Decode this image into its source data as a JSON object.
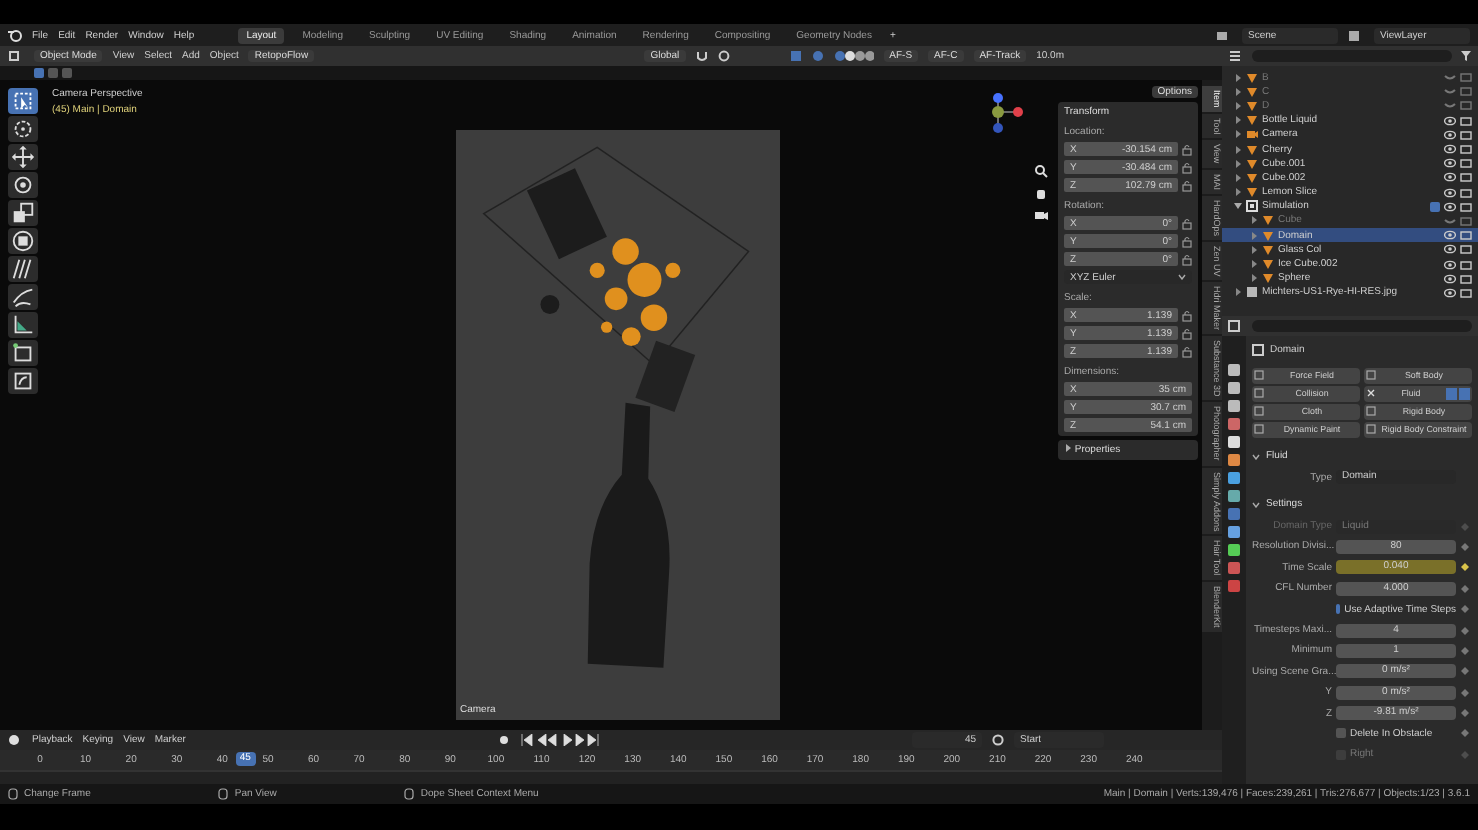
{
  "menu_bar": {
    "menus": [
      "File",
      "Edit",
      "Render",
      "Window",
      "Help"
    ],
    "workspace_tabs": [
      {
        "label": "Layout",
        "selected": true
      },
      {
        "label": "Modeling",
        "selected": false
      },
      {
        "label": "Sculpting",
        "selected": false
      },
      {
        "label": "UV Editing",
        "selected": false
      },
      {
        "label": "Shading",
        "selected": false
      },
      {
        "label": "Animation",
        "selected": false
      },
      {
        "label": "Rendering",
        "selected": false
      },
      {
        "label": "Compositing",
        "selected": false
      },
      {
        "label": "Geometry Nodes",
        "selected": false
      }
    ],
    "add_tab": "+",
    "scene": "Scene",
    "view_layer": "ViewLayer"
  },
  "viewport_header": {
    "mode": "Object Mode",
    "menus": [
      "View",
      "Select",
      "Add",
      "Object"
    ],
    "addon_menu": "RetopoFlow",
    "orientation": "Global",
    "af_buttons": [
      "AF-S",
      "AF-C",
      "AF-Track"
    ],
    "focus_distance": "10.0m",
    "options": "Options"
  },
  "toolbar": [
    {
      "kind": "select",
      "selected": true
    },
    {
      "kind": "cursor",
      "selected": false
    },
    {
      "kind": "move",
      "selected": false
    },
    {
      "kind": "rotate",
      "selected": false
    },
    {
      "kind": "scale",
      "selected": false
    },
    {
      "kind": "transform",
      "selected": false
    },
    {
      "kind": "annotate",
      "selected": false
    },
    {
      "kind": "draw",
      "selected": false
    },
    {
      "kind": "measure",
      "selected": false
    },
    {
      "kind": "add_cube",
      "selected": false
    },
    {
      "kind": "extra",
      "selected": false
    }
  ],
  "viewport": {
    "view_name": "Camera Perspective",
    "context": "(45) Main | Domain",
    "camera_label": "Camera"
  },
  "transform_panel": {
    "title": "Transform",
    "groups": [
      {
        "label": "Location:",
        "lockable": true,
        "fields": [
          {
            "axis": "X",
            "value": "-30.154 cm"
          },
          {
            "axis": "Y",
            "value": "-30.484 cm"
          },
          {
            "axis": "Z",
            "value": "102.79 cm"
          }
        ]
      },
      {
        "label": "Rotation:",
        "lockable": true,
        "fields": [
          {
            "axis": "X",
            "value": "0°"
          },
          {
            "axis": "Y",
            "value": "0°"
          },
          {
            "axis": "Z",
            "value": "0°"
          }
        ],
        "mode": "XYZ Euler"
      },
      {
        "label": "Scale:",
        "lockable": true,
        "fields": [
          {
            "axis": "X",
            "value": "1.139"
          },
          {
            "axis": "Y",
            "value": "1.139"
          },
          {
            "axis": "Z",
            "value": "1.139"
          }
        ]
      },
      {
        "label": "Dimensions:",
        "lockable": false,
        "fields": [
          {
            "axis": "X",
            "value": "35 cm"
          },
          {
            "axis": "Y",
            "value": "30.7 cm"
          },
          {
            "axis": "Z",
            "value": "54.1 cm"
          }
        ]
      }
    ],
    "properties_section": "Properties"
  },
  "sidebar_tabs": [
    {
      "label": "Item",
      "selected": true
    },
    {
      "label": "Tool",
      "selected": false
    },
    {
      "label": "View",
      "selected": false
    },
    {
      "label": "MAI",
      "selected": false
    },
    {
      "label": "HardOps",
      "selected": false
    },
    {
      "label": "Zen UV",
      "selected": false
    },
    {
      "label": "Hdri Maker",
      "selected": false
    },
    {
      "label": "Substance 3D",
      "selected": false
    },
    {
      "label": "Photographer",
      "selected": false
    },
    {
      "label": "Simply Addons",
      "selected": false
    },
    {
      "label": "Hair Tool",
      "selected": false
    },
    {
      "label": "BlenderKit",
      "selected": false
    }
  ],
  "outliner": {
    "items": [
      {
        "name": "B",
        "kind": "mesh",
        "selected": false,
        "hidden": true
      },
      {
        "name": "C",
        "kind": "mesh",
        "selected": false,
        "hidden": true
      },
      {
        "name": "D",
        "kind": "mesh",
        "selected": false,
        "hidden": true
      },
      {
        "name": "Bottle Liquid",
        "kind": "mesh",
        "selected": false,
        "hidden": false
      },
      {
        "name": "Camera",
        "kind": "camera",
        "selected": false,
        "hidden": false
      },
      {
        "name": "Cherry",
        "kind": "mesh",
        "selected": false,
        "hidden": false
      },
      {
        "name": "Cube.001",
        "kind": "mesh",
        "selected": false,
        "hidden": false
      },
      {
        "name": "Cube.002",
        "kind": "mesh",
        "selected": false,
        "hidden": false
      },
      {
        "name": "Lemon Slice",
        "kind": "mesh",
        "selected": false,
        "hidden": false
      },
      {
        "name": "Simulation",
        "kind": "collection",
        "selected": false,
        "hidden": false,
        "checked": true,
        "children": [
          {
            "name": "Cube",
            "kind": "mesh",
            "selected": false,
            "hidden": true
          },
          {
            "name": "Domain",
            "kind": "mesh",
            "selected": true,
            "hidden": false
          },
          {
            "name": "Glass Col",
            "kind": "mesh",
            "selected": false,
            "hidden": false
          },
          {
            "name": "Ice Cube.002",
            "kind": "mesh",
            "selected": false,
            "hidden": false
          },
          {
            "name": "Sphere",
            "kind": "mesh",
            "selected": false,
            "hidden": false
          }
        ]
      },
      {
        "name": "Michters-US1-Rye-HI-RES.jpg",
        "kind": "image",
        "selected": false,
        "hidden": false
      }
    ]
  },
  "properties": {
    "object_name": "Domain",
    "physics_buttons": [
      {
        "label": "Force Field",
        "enabled": false
      },
      {
        "label": "Soft Body",
        "enabled": false
      },
      {
        "label": "Collision",
        "enabled": false
      },
      {
        "label": "Fluid",
        "enabled": true
      },
      {
        "label": "Cloth",
        "enabled": false
      },
      {
        "label": "Rigid Body",
        "enabled": false
      },
      {
        "label": "Dynamic Paint",
        "enabled": false
      },
      {
        "label": "Rigid Body Constraint",
        "enabled": false
      }
    ],
    "fluid_panel": {
      "title": "Fluid",
      "type_label": "Type",
      "type_value": "Domain",
      "settings_title": "Settings",
      "rows": [
        {
          "kind": "dropdown",
          "label": "Domain Type",
          "value": "Liquid",
          "disabled": true,
          "keyframed": false
        },
        {
          "kind": "number",
          "label": "Resolution Divisi...",
          "value": "80",
          "disabled": false,
          "keyframed": false
        },
        {
          "kind": "number",
          "label": "Time Scale",
          "value": "0.040",
          "disabled": false,
          "keyframed": true
        },
        {
          "kind": "number",
          "label": "CFL Number",
          "value": "4.000",
          "disabled": false,
          "keyframed": false
        },
        {
          "kind": "checkbox",
          "label": "Use Adaptive Time Steps",
          "checked": true,
          "disabled": false,
          "keyframed": false
        },
        {
          "kind": "number",
          "label": "Timesteps Maxi...",
          "value": "4",
          "disabled": false,
          "keyframed": false
        },
        {
          "kind": "number",
          "label": "Minimum",
          "value": "1",
          "disabled": false,
          "keyframed": false
        },
        {
          "kind": "number",
          "label": "Using Scene Gra...",
          "value": "0 m/s²",
          "disabled": false,
          "keyframed": false
        },
        {
          "kind": "number",
          "label": "Y",
          "value": "0 m/s²",
          "disabled": false,
          "keyframed": false
        },
        {
          "kind": "number",
          "label": "Z",
          "value": "-9.81 m/s²",
          "disabled": false,
          "keyframed": false
        },
        {
          "kind": "checkbox",
          "label": "Delete In Obstacle",
          "checked": false,
          "disabled": false,
          "keyframed": false
        },
        {
          "kind": "checkbox",
          "label": "Right",
          "checked": false,
          "disabled": true,
          "keyframed": false
        }
      ]
    }
  },
  "timeline": {
    "menus": [
      "Playback",
      "Keying",
      "View",
      "Marker"
    ],
    "current_frame": "45",
    "start_label": "Start",
    "ticks": [
      "0",
      "10",
      "20",
      "30",
      "40",
      "50",
      "60",
      "70",
      "80",
      "90",
      "100",
      "110",
      "120",
      "130",
      "140",
      "150",
      "160",
      "170",
      "180",
      "190",
      "200",
      "210",
      "220",
      "230",
      "240"
    ],
    "playhead": "45"
  },
  "status_bar": {
    "hints": [
      "Change Frame",
      "Pan View",
      "Dope Sheet Context Menu"
    ],
    "stats": "Main | Domain | Verts:139,476 | Faces:239,261 | Tris:276,677 | Objects:1/23 | 3.6.1"
  }
}
